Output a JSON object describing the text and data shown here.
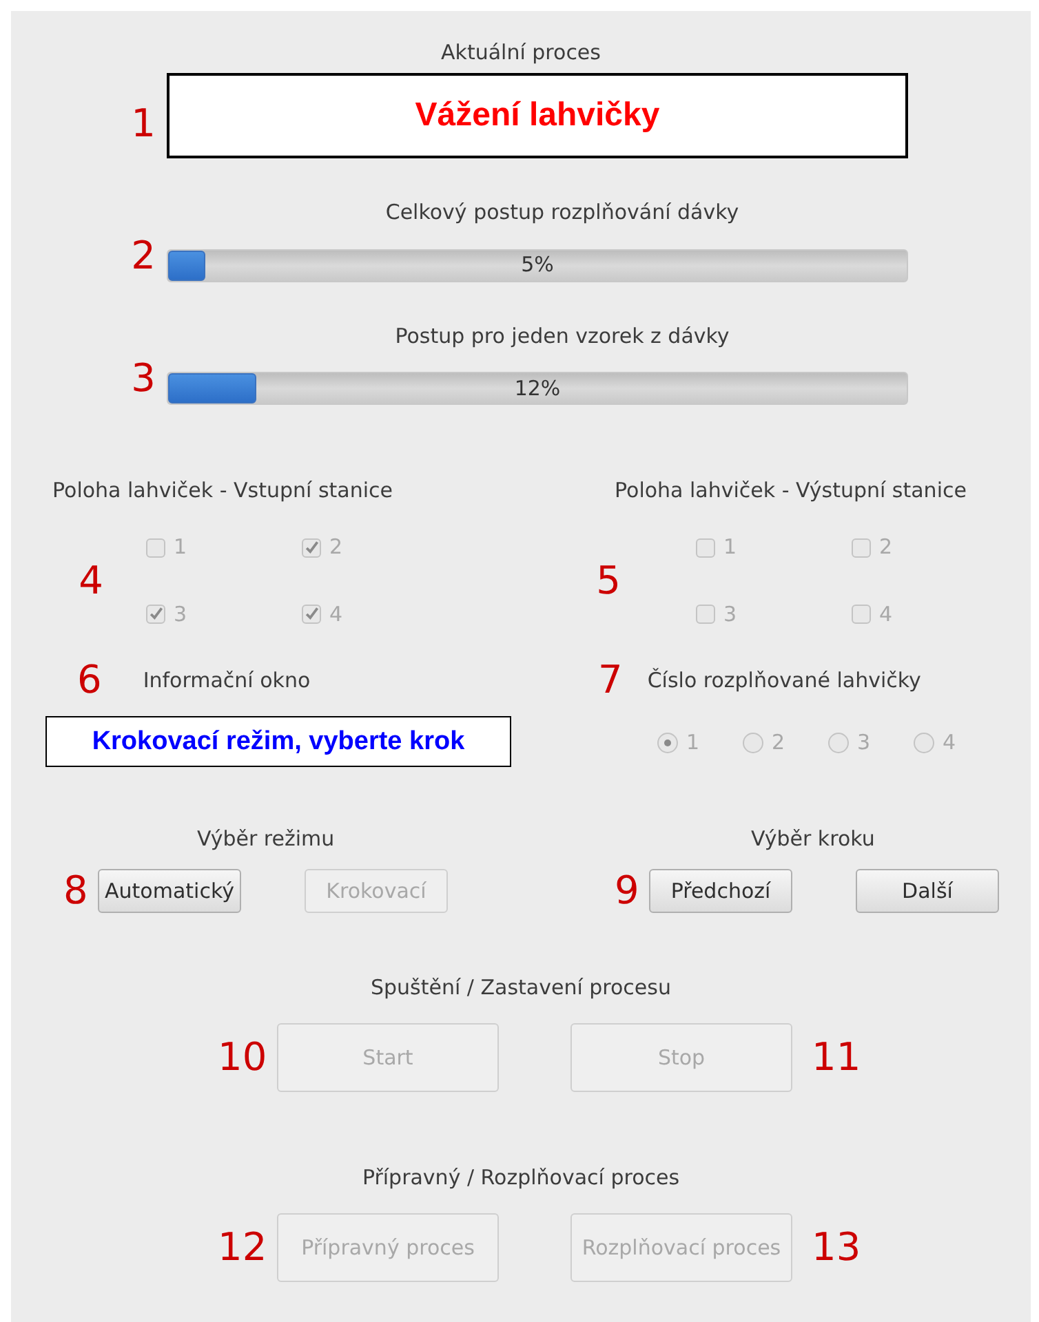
{
  "current_process": {
    "marker": "1",
    "title": "Aktuální proces",
    "value": "Vážení lahvičky"
  },
  "progress": [
    {
      "marker": "2",
      "title": "Celkový postup rozplňování dávky",
      "level": 0.05,
      "reading": "5%"
    },
    {
      "marker": "3",
      "title": "Postup pro jeden vzorek z dávky",
      "level": 0.12,
      "reading": "12%"
    }
  ],
  "input_positions": {
    "marker": "4",
    "title": "Poloha lahviček - Vstupní stanice",
    "items": [
      {
        "label": "1",
        "checked": false,
        "disabled": true
      },
      {
        "label": "2",
        "checked": true,
        "disabled": true
      },
      {
        "label": "3",
        "checked": true,
        "disabled": true
      },
      {
        "label": "4",
        "checked": true,
        "disabled": true
      }
    ]
  },
  "output_positions": {
    "marker": "5",
    "title": "Poloha lahviček - Výstupní stanice",
    "items": [
      {
        "label": "1",
        "checked": false,
        "disabled": true
      },
      {
        "label": "2",
        "checked": false,
        "disabled": true
      },
      {
        "label": "3",
        "checked": false,
        "disabled": true
      },
      {
        "label": "4",
        "checked": false,
        "disabled": true
      }
    ]
  },
  "info": {
    "marker": "6",
    "title": "Informační okno",
    "message": "Krokovací režim, vyberte krok"
  },
  "bottle_number": {
    "marker": "7",
    "title": "Číslo rozplňované lahvičky",
    "options": [
      {
        "label": "1",
        "selected": true,
        "disabled": true
      },
      {
        "label": "2",
        "selected": false,
        "disabled": true
      },
      {
        "label": "3",
        "selected": false,
        "disabled": true
      },
      {
        "label": "4",
        "selected": false,
        "disabled": true
      }
    ]
  },
  "mode": {
    "marker": "8",
    "title": "Výběr režimu",
    "buttons": [
      {
        "label": "Automatický",
        "disabled": false
      },
      {
        "label": "Krokovací",
        "disabled": true
      }
    ]
  },
  "step": {
    "marker": "9",
    "title": "Výběr kroku",
    "buttons": [
      {
        "label": "Předchozí",
        "disabled": false
      },
      {
        "label": "Další",
        "disabled": false
      }
    ]
  },
  "run": {
    "title": "Spuštění / Zastavení procesu",
    "buttons": [
      {
        "marker": "10",
        "label": "Start",
        "disabled": true
      },
      {
        "marker": "11",
        "label": "Stop",
        "disabled": true
      }
    ]
  },
  "process": {
    "title": "Přípravný / Rozplňovací proces",
    "buttons": [
      {
        "marker": "12",
        "label": "Přípravný proces",
        "disabled": true
      },
      {
        "marker": "13",
        "label": "Rozplňovací proces",
        "disabled": true
      }
    ]
  }
}
